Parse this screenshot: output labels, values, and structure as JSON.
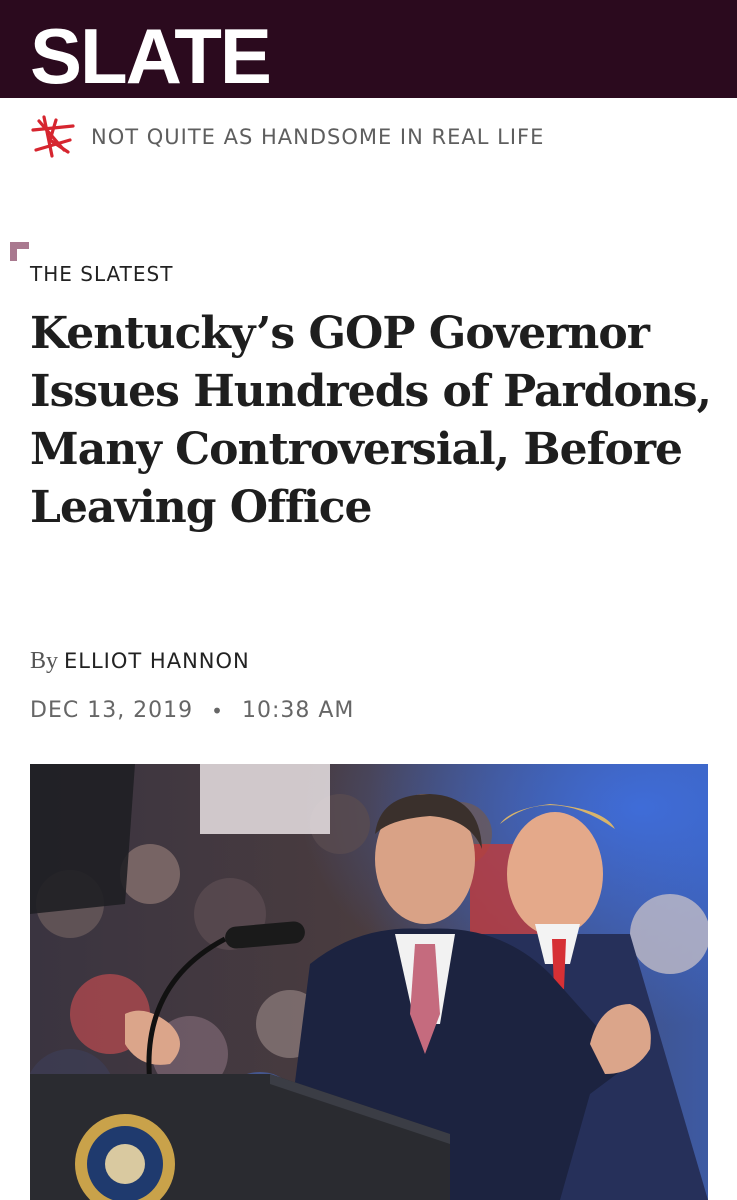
{
  "header": {
    "logo": "SLATE",
    "brand_color": "#2b0a1e"
  },
  "tagline": {
    "icon": "slate-star-icon",
    "text": "NOT QUITE AS HANDSOME IN REAL LIFE",
    "accent_color": "#d6252f"
  },
  "article": {
    "section": "THE SLATEST",
    "headline": "Kentucky’s GOP Governor Issues Hundreds of Pardons, Many Controversial, Before Leaving Office",
    "byline_prefix": "By",
    "author": "ELLIOT HANNON",
    "date": "DEC 13, 2019",
    "separator": "•",
    "time": "10:38 AM"
  },
  "photo": {
    "description_icon": "rally-photo"
  }
}
